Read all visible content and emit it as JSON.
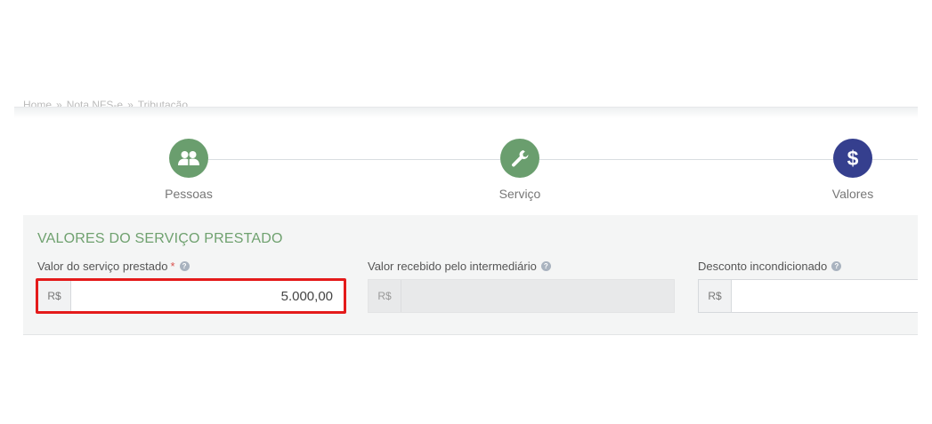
{
  "breadcrumb": {
    "items": [
      "Home",
      "Nota NFS-e",
      "Tributação"
    ]
  },
  "steps": [
    {
      "label": "Pessoas",
      "icon": "people-icon",
      "color": "#6a9e6e"
    },
    {
      "label": "Serviço",
      "icon": "wrench-icon",
      "color": "#6a9e6e"
    },
    {
      "label": "Valores",
      "icon": "dollar-icon",
      "color": "#353f8e"
    }
  ],
  "section": {
    "title": "VALORES DO SERVIÇO PRESTADO"
  },
  "fields": {
    "valor_servico": {
      "label": "Valor do serviço prestado",
      "required_mark": "*",
      "prefix": "R$",
      "value": "5.000,00"
    },
    "valor_intermediario": {
      "label": "Valor recebido pelo intermediário",
      "prefix": "R$",
      "value": ""
    },
    "desconto": {
      "label": "Desconto incondicionado",
      "prefix": "R$",
      "value": ""
    }
  },
  "colors": {
    "accent_green": "#6fa16f",
    "step_active": "#353f8e",
    "highlight_red": "#e41b1b"
  }
}
